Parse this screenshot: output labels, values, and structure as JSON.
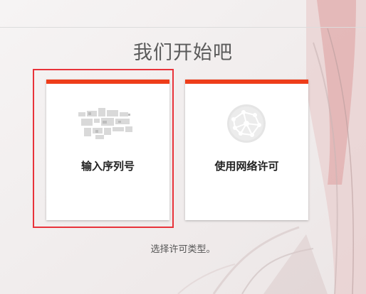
{
  "page": {
    "title": "我们开始吧",
    "hint": "选择许可类型。"
  },
  "options": {
    "serial": {
      "label": "输入序列号",
      "icon": "serial-number-icon",
      "selected": true
    },
    "network": {
      "label": "使用网络许可",
      "icon": "network-globe-icon",
      "selected": false
    }
  },
  "colors": {
    "accent_bar": "#ee3d1a",
    "selection_border": "#e8333a",
    "background": "#f4f2f2"
  }
}
